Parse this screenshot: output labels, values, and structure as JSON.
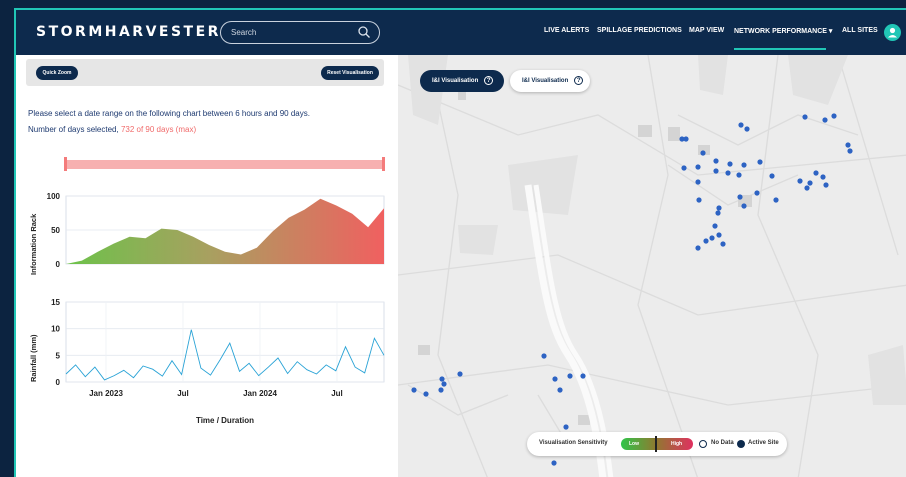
{
  "header": {
    "logo": "STORMHARVESTER",
    "search_placeholder": "Search",
    "nav": [
      "LIVE ALERTS",
      "SPILLAGE PREDICTIONS",
      "MAP VIEW",
      "NETWORK PERFORMANCE",
      "ALL SITES"
    ],
    "active_nav": "NETWORK PERFORMANCE"
  },
  "left_panel": {
    "quick_zoom": "Quick Zoom",
    "reset_visualisation": "Reset Visualisation",
    "instruction": "Please select a date range on the following chart between 6 hours and 90 days.",
    "days_selected_label": "Number of days selected,",
    "days_selected_value": "732 of 90 days (max)"
  },
  "map": {
    "btn_active": "I&I Visualisation",
    "btn_inactive": "I&I Visualisation",
    "legend": {
      "title": "Visualisation Sensitivity",
      "low": "Low",
      "high": "High",
      "no_data": "No Data",
      "active_site": "Active Site"
    }
  },
  "colors": {
    "navy": "#0d2a4d",
    "teal": "#21c6b6",
    "rain": "#2aa3d6",
    "green": "#6cc24a",
    "red": "#f06a6a",
    "marker": "#2d63c3"
  },
  "chart_data": [
    {
      "type": "area",
      "ylabel": "Information Rack",
      "ylim": [
        0,
        100
      ],
      "yticks": [
        0,
        50,
        100
      ],
      "x": [
        0,
        5,
        10,
        15,
        20,
        25,
        30,
        35,
        40,
        45,
        50,
        55,
        60,
        65,
        70,
        75,
        80,
        85,
        90,
        95,
        100
      ],
      "values": [
        0,
        5,
        18,
        30,
        40,
        38,
        52,
        50,
        40,
        28,
        18,
        14,
        24,
        48,
        68,
        80,
        96,
        86,
        74,
        54,
        82
      ]
    },
    {
      "type": "line",
      "xlabel": "Time / Duration",
      "ylabel": "Rainfall (mm)",
      "ylim": [
        0,
        15
      ],
      "yticks": [
        0,
        5,
        10,
        15
      ],
      "xticks": [
        "Jan 2023",
        "Jul",
        "Jan 2024",
        "Jul"
      ],
      "x": [
        0,
        3,
        6,
        9,
        12,
        15,
        18,
        21,
        24,
        27,
        30,
        33,
        36,
        39,
        42,
        45,
        48,
        51,
        54,
        57,
        60,
        63,
        66,
        69,
        72,
        75,
        78,
        81,
        84,
        87,
        90,
        93,
        96,
        99
      ],
      "values": [
        1.5,
        3.2,
        1.0,
        2.8,
        0.4,
        1.2,
        2.2,
        0.8,
        3.0,
        2.4,
        1.1,
        4.0,
        1.4,
        9.8,
        2.6,
        1.3,
        4.2,
        7.3,
        2.0,
        3.5,
        1.2,
        2.8,
        4.5,
        1.6,
        3.8,
        2.3,
        1.5,
        3.2,
        2.1,
        6.6,
        2.8,
        1.7,
        8.2,
        5.0
      ]
    }
  ]
}
